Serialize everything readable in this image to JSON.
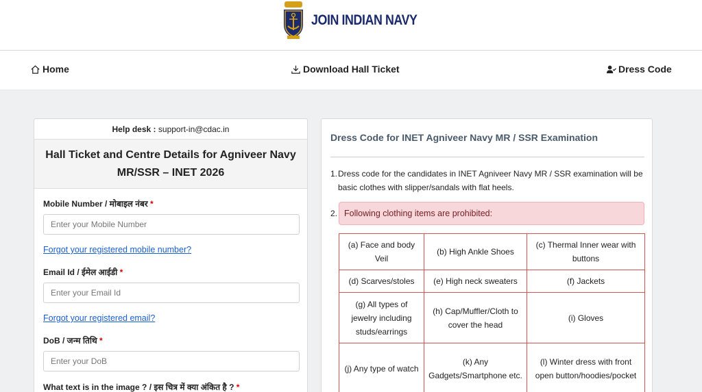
{
  "brand": {
    "name": "JOIN INDIAN NAVY",
    "accent": "#1a2a6c",
    "gold": "#d4a017"
  },
  "nav": {
    "home": "Home",
    "download": "Download Hall Ticket",
    "dress": "Dress Code"
  },
  "form": {
    "helpdesk_label": "Help desk :",
    "helpdesk_email": "support-in@cdac.in",
    "title_line1": "Hall Ticket and Centre Details for Agniveer Navy",
    "title_line2": "MR/SSR – INET 2026",
    "mobile_label": "Mobile Number / मोबाइल नंबर",
    "mobile_placeholder": "Enter your Mobile Number",
    "mobile_forgot": "Forgot your registered mobile number?",
    "email_label": "Email Id / ईमेल आईडी",
    "email_placeholder": "Enter your Email Id",
    "email_forgot": "Forgot your registered email?",
    "dob_label": "DoB / जन्म तिथि",
    "dob_placeholder": "Enter your DoB",
    "captcha_label": "What text is in the image ? / इस चित्र में क्या अंकित है ?",
    "required_mark": "*"
  },
  "dress_code": {
    "title": "Dress Code for INET Agniveer Navy MR / SSR Examination",
    "point1_num": "1.",
    "point1_text": "Dress code for the candidates in INET Agniveer Navy MR / SSR examination will be basic clothes with slipper/sandals with flat heels.",
    "point2_num": "2.",
    "point2_text": "Following clothing items are prohibited:",
    "table": [
      [
        "(a) Face and body Veil",
        "(b) High Ankle Shoes",
        "(c) Thermal Inner wear with buttons"
      ],
      [
        "(d) Scarves/stoles",
        "(e) High neck sweaters",
        "(f) Jackets"
      ],
      [
        "(g) All types of jewelry including studs/earrings",
        "(h) Cap/Muffler/Cloth to cover the head",
        "(i) Gloves"
      ],
      [
        "(j) Any type of watch",
        "(k) Any Gadgets/Smartphone etc.",
        "(l) Winter dress with front open button/hoodies/pocket"
      ]
    ]
  }
}
